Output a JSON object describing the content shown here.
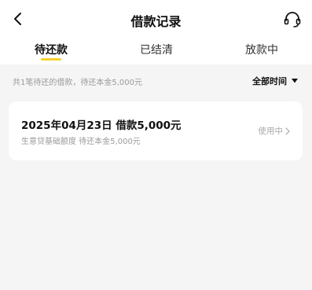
{
  "header": {
    "title": "借款记录",
    "back_icon": "chevron-left-icon",
    "support_icon": "headset-icon"
  },
  "tabs": [
    {
      "label": "待还款",
      "active": true
    },
    {
      "label": "已结清",
      "active": false
    },
    {
      "label": "放款中",
      "active": false
    }
  ],
  "accent_color": "#f6d12e",
  "summary": {
    "text": "共1笔待还的借款，待还本金5,000元",
    "filter_label": "全部时间"
  },
  "loans": [
    {
      "title": "2025年04月23日 借款5,000元",
      "subtitle": "生意贷基础额度 待还本金5,000元",
      "status": "使用中"
    }
  ]
}
